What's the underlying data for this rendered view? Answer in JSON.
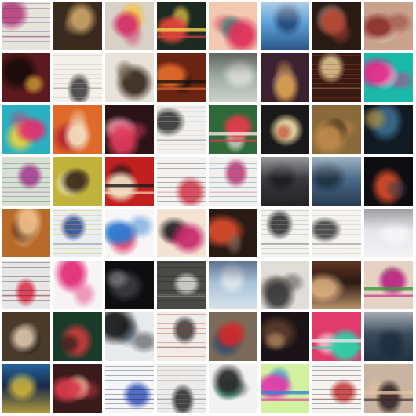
{
  "grid": {
    "rows": 8,
    "cols": 8,
    "background": "#ffffff",
    "tiles": [
      {
        "bg": "#e9e4dc",
        "c1": "#b0286e",
        "c2": "#3a4f78",
        "style": "doc"
      },
      {
        "bg": "#3b2a1e",
        "c1": "#c9a266",
        "c2": "#1a1410",
        "style": "blob"
      },
      {
        "bg": "#d8d2c6",
        "c1": "#d32f6a",
        "c2": "#f5c242",
        "style": "blob"
      },
      {
        "bg": "#1d2a22",
        "c1": "#e0433a",
        "c2": "#f1d34a",
        "style": "poster"
      },
      {
        "bg": "#f2c8b0",
        "c1": "#e02f5a",
        "c2": "#2d8a7a",
        "style": "blob"
      },
      {
        "bg": "#5aa0d8",
        "c1": "#e8eef4",
        "c2": "#1c3c6a",
        "style": "sky"
      },
      {
        "bg": "#2a1a14",
        "c1": "#b8452f",
        "c2": "#7c8b9a",
        "style": "blob"
      },
      {
        "bg": "#c8a28a",
        "c1": "#8a2f2a",
        "c2": "#f0e2d2",
        "style": "blob"
      },
      {
        "bg": "#5c1a1e",
        "c1": "#1a0a0a",
        "c2": "#f2c63a",
        "style": "dark"
      },
      {
        "bg": "#f4f0ea",
        "c1": "#2a2a2a",
        "c2": "#b8b2a8",
        "style": "doc"
      },
      {
        "bg": "#e8e2d8",
        "c1": "#3a2a1e",
        "c2": "#6a5a4a",
        "style": "dark"
      },
      {
        "bg": "#6a2414",
        "c1": "#e26a2a",
        "c2": "#1a120e",
        "style": "poster"
      },
      {
        "bg": "#9aa8a2",
        "c1": "#3a3a32",
        "c2": "#e2e4dc",
        "style": "sky"
      },
      {
        "bg": "#3a2230",
        "c1": "#d8a04a",
        "c2": "#5a3aa8",
        "style": "blob"
      },
      {
        "bg": "#3a1a12",
        "c1": "#f0d8a0",
        "c2": "#a84a2a",
        "style": "doc"
      },
      {
        "bg": "#1ab8a8",
        "c1": "#e22a8a",
        "c2": "#f4f0f2",
        "style": "blob"
      },
      {
        "bg": "#2ab0c0",
        "c1": "#e2306e",
        "c2": "#f0d23a",
        "style": "blob"
      },
      {
        "bg": "#e06a2a",
        "c1": "#f4e0c2",
        "c2": "#b22030",
        "style": "blob"
      },
      {
        "bg": "#2a1418",
        "c1": "#e03a5a",
        "c2": "#f2a0b0",
        "style": "blob"
      },
      {
        "bg": "#f2f0ee",
        "c1": "#1a1a1a",
        "c2": "#c8c4be",
        "style": "doc"
      },
      {
        "bg": "#2f6a3a",
        "c1": "#e23a4a",
        "c2": "#f2e6e0",
        "style": "poster"
      },
      {
        "bg": "#1a1a1a",
        "c1": "#e8d8a0",
        "c2": "#c03a2a",
        "style": "dark"
      },
      {
        "bg": "#8a6a3a",
        "c1": "#c08a4a",
        "c2": "#2a1a10",
        "style": "blob"
      },
      {
        "bg": "#0f1a22",
        "c1": "#3a6a8a",
        "c2": "#c89a3a",
        "style": "dark"
      },
      {
        "bg": "#d8e0d2",
        "c1": "#a02a8a",
        "c2": "#2a6a5a",
        "style": "doc"
      },
      {
        "bg": "#c0b23a",
        "c1": "#3a2a1a",
        "c2": "#f0e8c0",
        "style": "blob"
      },
      {
        "bg": "#c2201e",
        "c1": "#f2e0c2",
        "c2": "#1a1a1a",
        "style": "poster"
      },
      {
        "bg": "#f4f2f0",
        "c1": "#d02a3a",
        "c2": "#2a2a2a",
        "style": "doc"
      },
      {
        "bg": "#f2f0ee",
        "c1": "#b82a6a",
        "c2": "#2a7a8a",
        "style": "doc"
      },
      {
        "bg": "#3a3a3e",
        "c1": "#d8dade",
        "c2": "#1a1a1e",
        "style": "sky"
      },
      {
        "bg": "#4a6a8a",
        "c1": "#d8e2ea",
        "c2": "#1a2a3a",
        "style": "sky"
      },
      {
        "bg": "#0e0e12",
        "c1": "#d24a2a",
        "c2": "#3a3a4a",
        "style": "dark"
      },
      {
        "bg": "#b86a2a",
        "c1": "#f0c08a",
        "c2": "#3a1a0e",
        "style": "blob"
      },
      {
        "bg": "#e8eef2",
        "c1": "#1a3a8a",
        "c2": "#e2b02a",
        "style": "doc"
      },
      {
        "bg": "#f6f6f6",
        "c1": "#2a7ad2",
        "c2": "#e23a6a",
        "style": "blob"
      },
      {
        "bg": "#f4e2d2",
        "c1": "#c82a6a",
        "c2": "#1a1a1a",
        "style": "blob"
      },
      {
        "bg": "#2a1a14",
        "c1": "#d84a2a",
        "c2": "#8a6a5a",
        "style": "dark"
      },
      {
        "bg": "#f2f2f0",
        "c1": "#1a1a1a",
        "c2": "#9a9a96",
        "style": "doc"
      },
      {
        "bg": "#f6f4f0",
        "c1": "#2a2a2a",
        "c2": "#b8b4ae",
        "style": "doc"
      },
      {
        "bg": "#e6e6ea",
        "c1": "#6a6a72",
        "c2": "#f8f8fa",
        "style": "sky"
      },
      {
        "bg": "#e8e6e6",
        "c1": "#d8203a",
        "c2": "#1a1a1a",
        "style": "doc"
      },
      {
        "bg": "#f8f4f4",
        "c1": "#e2307a",
        "c2": "#f2a0c0",
        "style": "blob"
      },
      {
        "bg": "#0e0e10",
        "c1": "#3a3a3e",
        "c2": "#8a8a90",
        "style": "dark"
      },
      {
        "bg": "#4a4a46",
        "c1": "#e8e6e2",
        "c2": "#1a1a1a",
        "style": "doc"
      },
      {
        "bg": "#a8c2d8",
        "c1": "#2a3a5a",
        "c2": "#e8eef2",
        "style": "sky"
      },
      {
        "bg": "#e0dcd8",
        "c1": "#3a3a3a",
        "c2": "#8a7a6a",
        "style": "blob"
      },
      {
        "bg": "#2a1a14",
        "c1": "#8a4a2a",
        "c2": "#f0c08a",
        "style": "sky"
      },
      {
        "bg": "#e6d2c2",
        "c1": "#c02a8a",
        "c2": "#3a9a3a",
        "style": "poster"
      },
      {
        "bg": "#4a3a2a",
        "c1": "#d8c2a8",
        "c2": "#1a140e",
        "style": "blob"
      },
      {
        "bg": "#1a3a2a",
        "c1": "#c83a3a",
        "c2": "#0e1a14",
        "style": "dark"
      },
      {
        "bg": "#e8eaec",
        "c1": "#1a1a1a",
        "c2": "#6a7a8a",
        "style": "blob"
      },
      {
        "bg": "#f0ece6",
        "c1": "#2a2a2a",
        "c2": "#c02a2a",
        "style": "doc"
      },
      {
        "bg": "#7a6a5a",
        "c1": "#d02a2a",
        "c2": "#2a4a6a",
        "style": "blob"
      },
      {
        "bg": "#1a1418",
        "c1": "#5a3a2a",
        "c2": "#c89a6a",
        "style": "dark"
      },
      {
        "bg": "#e23a6a",
        "c1": "#2ad2a8",
        "c2": "#f0e2e8",
        "style": "poster"
      },
      {
        "bg": "#3a4a5a",
        "c1": "#e8ecf0",
        "c2": "#1a2a3a",
        "style": "sky"
      },
      {
        "bg": "#1a2a4a",
        "c1": "#2a8ad2",
        "c2": "#e2c23a",
        "style": "sky"
      },
      {
        "bg": "#3a1a1a",
        "c1": "#d83a4a",
        "c2": "#f0c8a0",
        "style": "blob"
      },
      {
        "bg": "#f4f6fa",
        "c1": "#2a4ab8",
        "c2": "#1a1a1a",
        "style": "doc"
      },
      {
        "bg": "#eeeceb",
        "c1": "#1a1a1a",
        "c2": "#8a8a86",
        "style": "doc"
      },
      {
        "bg": "#f2f2f2",
        "c1": "#2a2a2a",
        "c2": "#3a9a7a",
        "style": "blob"
      },
      {
        "bg": "#d2f0a0",
        "c1": "#e23aa8",
        "c2": "#2a8ad2",
        "style": "poster"
      },
      {
        "bg": "#f6f4f0",
        "c1": "#c02a2a",
        "c2": "#1a1a1a",
        "style": "doc"
      },
      {
        "bg": "#c8b4a0",
        "c1": "#3a2a2a",
        "c2": "#e2c2a0",
        "style": "poster"
      }
    ]
  }
}
